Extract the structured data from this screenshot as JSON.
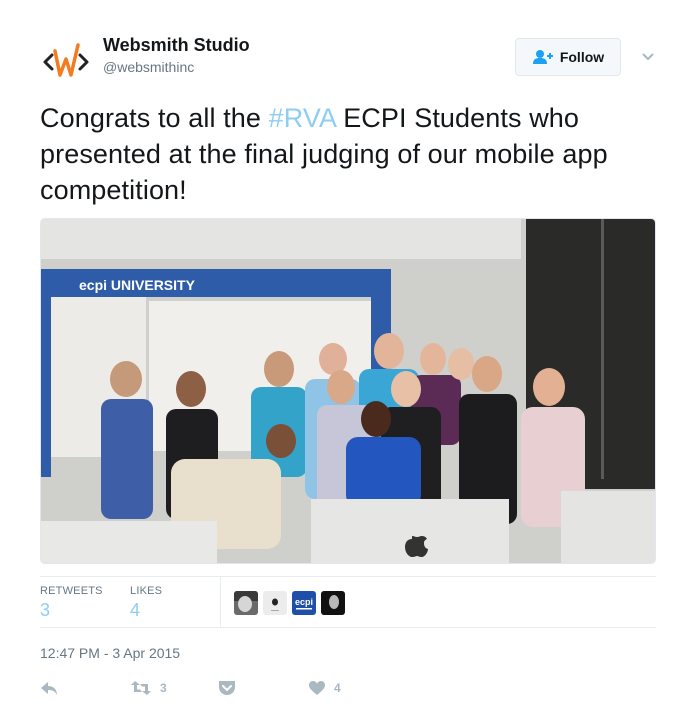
{
  "account": {
    "full_name": "Websmith Studio",
    "handle": "@websmithinc",
    "logo_colors": {
      "brackets": "#222222",
      "w": "#f47b20"
    }
  },
  "follow_button": {
    "label": "Follow",
    "icon": "follow-user-icon",
    "accent": "#1da1f2"
  },
  "more_menu": {
    "icon": "chevron-down-icon"
  },
  "tweet": {
    "text_before": "Congrats to all the ",
    "hashtag": "#RVA",
    "text_after": " ECPI Students who presented at the final judging of our mobile app competition!",
    "hashtag_color": "#8ecdf3"
  },
  "photo": {
    "description": "Group photo of ECPI University students in a classroom with iMacs",
    "banner_text": "ecpi UNIVERSITY"
  },
  "stats": {
    "retweets_label": "RETWEETS",
    "retweets_value": "3",
    "likes_label": "LIKES",
    "likes_value": "4",
    "likers": [
      {
        "name": "liker-1",
        "kind": "photo-grayscale-man"
      },
      {
        "name": "liker-2",
        "kind": "apple-logo"
      },
      {
        "name": "liker-3",
        "kind": "ecpi-logo",
        "text": "ecpi"
      },
      {
        "name": "liker-4",
        "kind": "photo-dark-woman"
      }
    ]
  },
  "timestamp": "12:47 PM - 3 Apr 2015",
  "actions": {
    "reply": {
      "icon": "reply-icon"
    },
    "retweet": {
      "icon": "retweet-icon",
      "count": "3"
    },
    "save": {
      "icon": "pocket-icon"
    },
    "like": {
      "icon": "heart-icon",
      "count": "4"
    },
    "icon_color": "#aab8c2"
  }
}
